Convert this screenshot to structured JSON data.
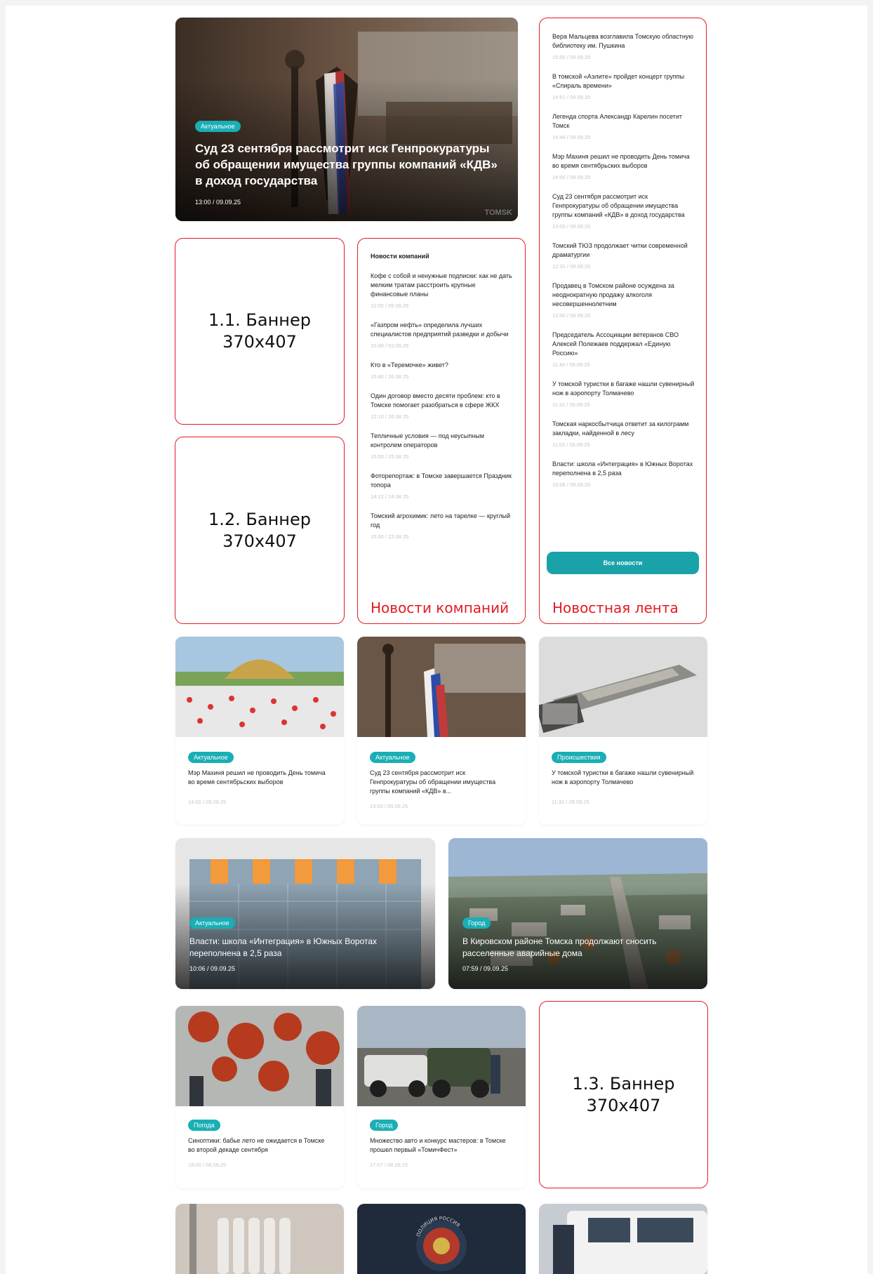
{
  "hero": {
    "tag": "Актуальное",
    "title": "Суд 23 сентября рассмотрит иск Генпрокуратуры об обращении имущества группы компаний «КДВ» в доход государства",
    "time": "13:00 / 09.09.25",
    "watermark": "TOMSK"
  },
  "feed": {
    "label": "Новостная лента",
    "button": "Все новости",
    "items": [
      {
        "title": "Вера Мальцева возглавила Томскую областную библиотеку им. Пушкина",
        "time": "15:00 / 09.09.25"
      },
      {
        "title": "В томской «Аэлите» пройдет концерт группы «Спираль времени»",
        "time": "14:51 / 09.09.25"
      },
      {
        "title": "Легенда спорта Александр Карелин посетит Томск",
        "time": "14:40 / 09.09.25"
      },
      {
        "title": "Мэр Махиня решил не проводить День томича во время сентябрьских выборов",
        "time": "14:00 / 09.09.25"
      },
      {
        "title": "Суд 23 сентября рассмотрит иск Генпрокуратуры об обращении имущества группы компаний «КДВ» в доход государства",
        "time": "13:00 / 09.09.25"
      },
      {
        "title": "Томский ТЮЗ продолжает читки современной драматургии",
        "time": "12:31 / 09.09.25"
      },
      {
        "title": "Продавец в Томском районе осуждена за неоднократную продажу алкоголя несовершеннолетним",
        "time": "12:00 / 09.09.25"
      },
      {
        "title": "Председатель Ассоциации ветеранов СВО Алексей Полежаев поддержал «Единую Россию»",
        "time": "11:40 / 09.09.25"
      },
      {
        "title": "У томской туристки в багаже нашли сувенирный нож в аэропорту Толмачево",
        "time": "11:32 / 09.09.25"
      },
      {
        "title": "Томская наркосбытчица ответит за килограмм закладки, найденной в лесу",
        "time": "11:03 / 09.09.25"
      },
      {
        "title": "Власти: школа «Интеграция» в Южных Воротах переполнена в 2,5 раза",
        "time": "10:06 / 09.09.25"
      }
    ]
  },
  "banners": {
    "b11": {
      "title": "1.1. Баннер",
      "size": "370x407"
    },
    "b12": {
      "title": "1.2. Баннер",
      "size": "370x407"
    },
    "b13": {
      "title": "1.3. Баннер",
      "size": "370x407"
    }
  },
  "company_news": {
    "heading": "Новости компаний",
    "label": "Новости компаний",
    "items": [
      {
        "title": "Кофе с собой и ненужные подписки: как не дать мелким тратам расстроить крупные финансовые планы",
        "time": "12:00 / 09.09.25"
      },
      {
        "title": "«Газпром нефть» определила лучших специалистов предприятий разведки и добычи",
        "time": "10:40 / 03.09.25"
      },
      {
        "title": "Кто в «Теремочке» живет?",
        "time": "15:40 / 26.08.25"
      },
      {
        "title": "Один договор вместо десяти проблем: кто в Томске помогает разобраться в сфере ЖКХ",
        "time": "12:10 / 26.08.25"
      },
      {
        "title": "Тепличные условия — под неусыпным контролем операторов",
        "time": "10:00 / 25.08.25"
      },
      {
        "title": "Фоторепортаж: в Томске завершается Праздник топора",
        "time": "14:12 / 24.08.25"
      },
      {
        "title": "Томский агрохимик: лето на тарелке — круглый год",
        "time": "10:30 / 22.08.25"
      }
    ]
  },
  "cards_row1": [
    {
      "tag": "Актуальное",
      "title": "Мэр Махиня решил не проводить День томича во время сентябрьских выборов",
      "time": "14:00 / 09.09.25"
    },
    {
      "tag": "Актуальное",
      "title": "Суд 23 сентября рассмотрит иск Генпрокуратуры об обращении имущества группы компаний «КДВ» в...",
      "time": "13:00 / 09.09.25"
    },
    {
      "tag": "Происшествия",
      "title": "У томской туристки в багаже нашли сувенирный нож в аэропорту Толмачево",
      "time": "11:32 / 09.09.25"
    }
  ],
  "wide_cards": [
    {
      "tag": "Актуальное",
      "title": "Власти: школа «Интеграция» в Южных Воротах переполнена в 2,5 раза",
      "time": "10:06 / 09.09.25"
    },
    {
      "tag": "Город",
      "title": "В Кировском районе Томска продолжают сносить расселенные аварийные дома",
      "time": "07:59 / 09.09.25"
    }
  ],
  "cards_row2": [
    {
      "tag": "Погода",
      "title": "Синоптики: бабье лето не ожидается в Томске во второй декаде сентября",
      "time": "18:00 / 08.09.25"
    },
    {
      "tag": "Город",
      "title": "Множество авто и конкурс мастеров: в Томске прошел первый «ТомичФест»",
      "time": "17:07 / 08.09.25"
    }
  ],
  "badge_text": "ПОЛИЦИЯ РОССИЯ",
  "colors": {
    "accent": "#1aaeb5",
    "annotation": "#e31b23"
  }
}
